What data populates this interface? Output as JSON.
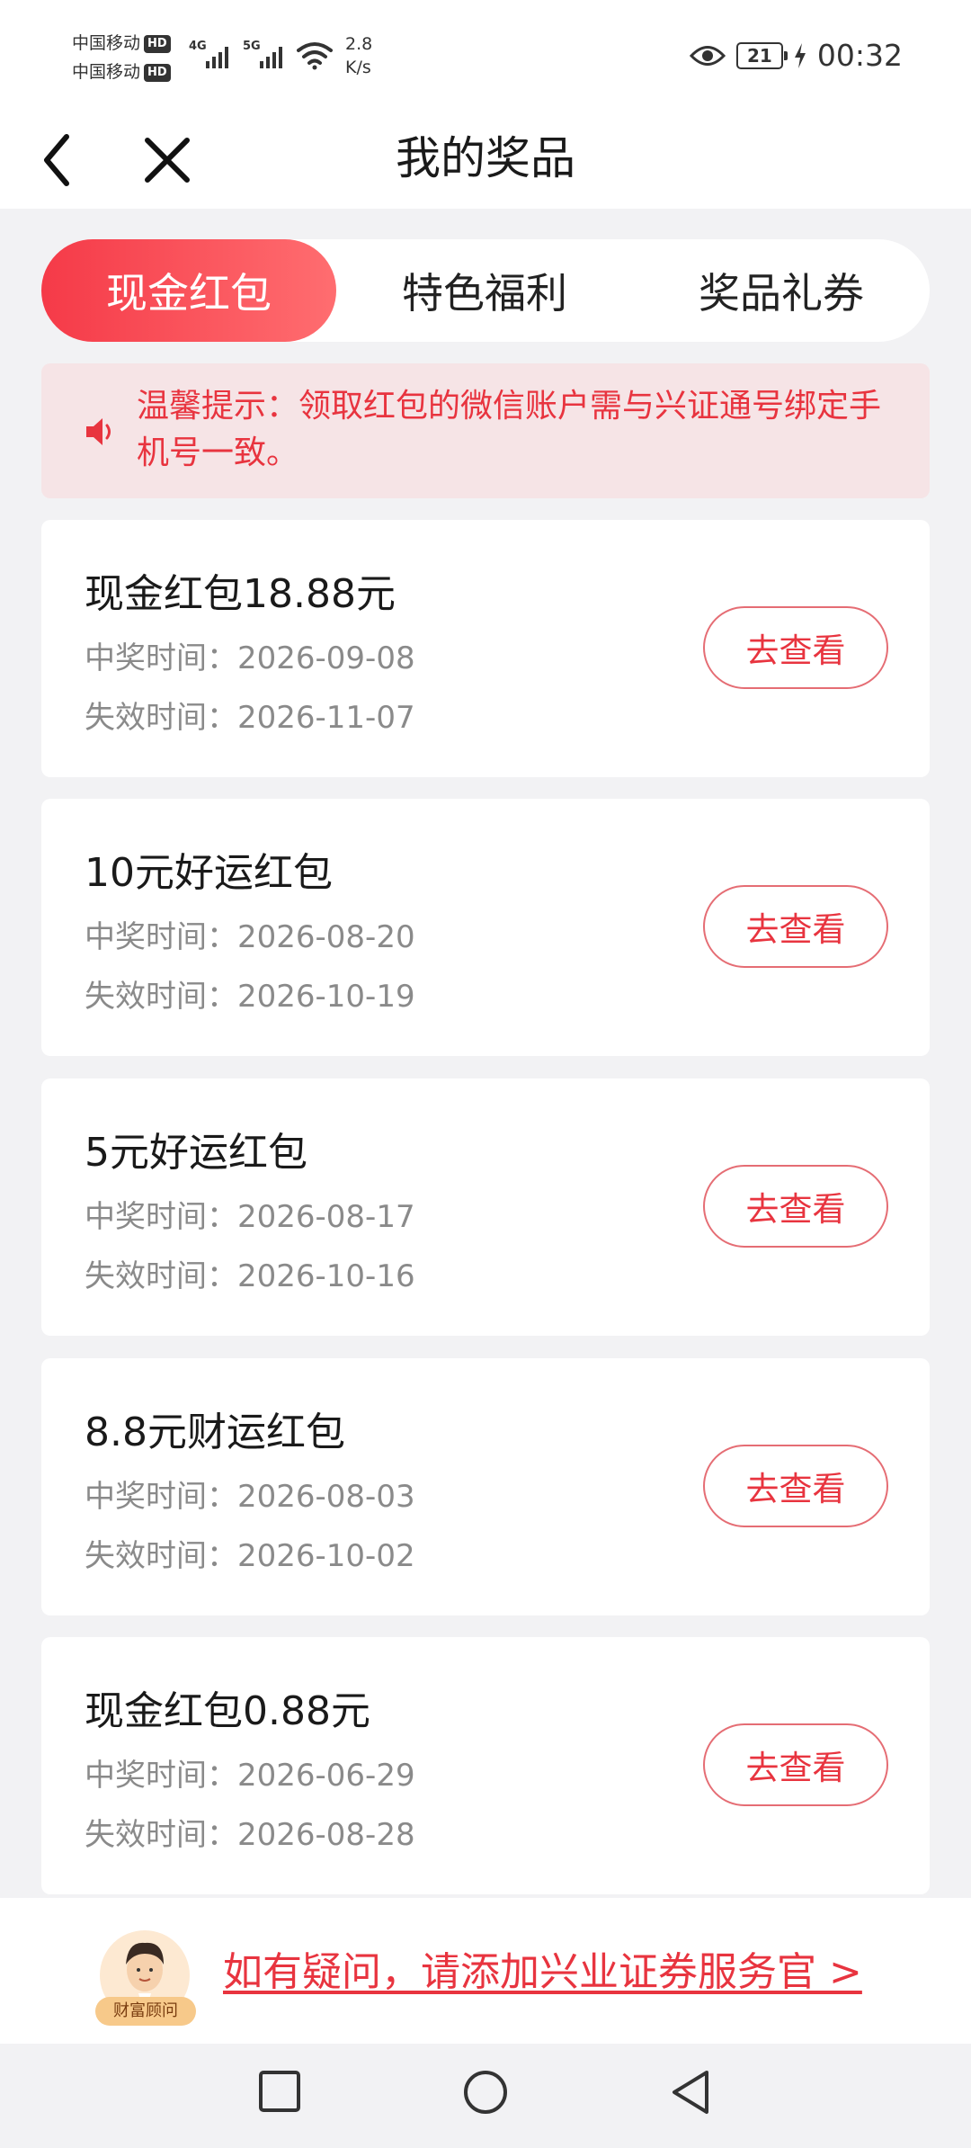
{
  "status_bar": {
    "carrier1": "中国移动",
    "carrier2": "中国移动",
    "hd_badge": "HD",
    "sig1_tag": "4G",
    "sig2_tag": "5G",
    "net_speed_value": "2.8",
    "net_speed_unit": "K/s",
    "battery": "21",
    "time": "00:32"
  },
  "nav": {
    "title": "我的奖品"
  },
  "tabs": [
    {
      "label": "现金红包",
      "active": true
    },
    {
      "label": "特色福利",
      "active": false
    },
    {
      "label": "奖品礼券",
      "active": false
    }
  ],
  "notice": {
    "text": "温馨提示：领取红包的微信账户需与兴证通号绑定手机号一致。"
  },
  "prizes": [
    {
      "title": "现金红包18.88元",
      "won": "中奖时间：2026-09-08",
      "expire": "失效时间：2026-11-07",
      "button": "去查看"
    },
    {
      "title": "10元好运红包",
      "won": "中奖时间：2026-08-20",
      "expire": "失效时间：2026-10-19",
      "button": "去查看"
    },
    {
      "title": "5元好运红包",
      "won": "中奖时间：2026-08-17",
      "expire": "失效时间：2026-10-16",
      "button": "去查看"
    },
    {
      "title": "8.8元财运红包",
      "won": "中奖时间：2026-08-03",
      "expire": "失效时间：2026-10-02",
      "button": "去查看"
    },
    {
      "title": "现金红包0.88元",
      "won": "中奖时间：2026-06-29",
      "expire": "失效时间：2026-08-28",
      "button": "去查看"
    }
  ],
  "help": {
    "avatar_tag": "财富顾问",
    "link": "如有疑问，请添加兴业证券服务官 >"
  },
  "colors": {
    "accent": "#e8343f",
    "tab_gradient_start": "#f53a48",
    "tab_gradient_end": "#ff6d70",
    "notice_bg": "#f6e4e6",
    "page_bg": "#f2f2f4"
  }
}
